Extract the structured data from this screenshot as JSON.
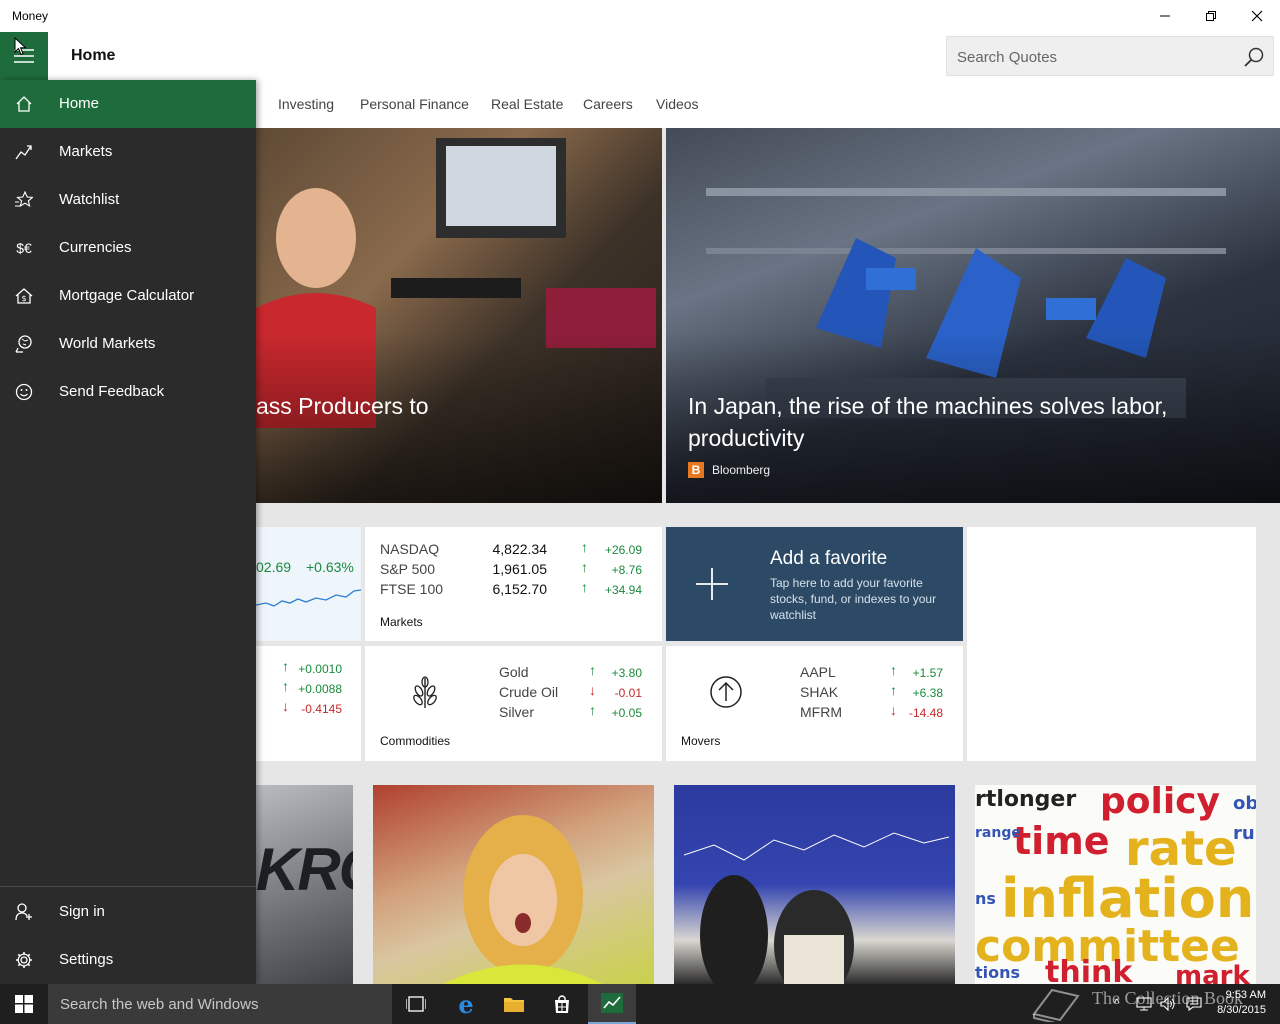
{
  "window": {
    "title": "Money"
  },
  "header": {
    "page_title": "Home",
    "search_placeholder": "Search Quotes"
  },
  "tabs": [
    "Investing",
    "Personal Finance",
    "Real Estate",
    "Careers",
    "Videos"
  ],
  "hero": [
    {
      "headline": "ass Producers to"
    },
    {
      "headline": "In Japan, the rise of the machines solves labor, productivity",
      "source": "Bloomberg"
    }
  ],
  "currency_card": {
    "value": "02.69",
    "change": "+0.63%"
  },
  "markets_card": {
    "label": "Markets",
    "rows": [
      {
        "name": "NASDAQ",
        "value": "4,822.34",
        "change": "+26.09",
        "direction": "up"
      },
      {
        "name": "S&P 500",
        "value": "1,961.05",
        "change": "+8.76",
        "direction": "up"
      },
      {
        "name": "FTSE 100",
        "value": "6,152.70",
        "change": "+34.94",
        "direction": "up"
      }
    ]
  },
  "add_favorite": {
    "title": "Add a favorite",
    "desc": "Tap here to add your favorite stocks, fund, or indexes to your watchlist"
  },
  "currency_changes": [
    {
      "change": "+0.0010",
      "direction": "up"
    },
    {
      "change": "+0.0088",
      "direction": "up"
    },
    {
      "change": "-0.4145",
      "direction": "down"
    }
  ],
  "commodities_card": {
    "label": "Commodities",
    "rows": [
      {
        "name": "Gold",
        "change": "+3.80",
        "direction": "up"
      },
      {
        "name": "Crude Oil",
        "change": "-0.01",
        "direction": "down"
      },
      {
        "name": "Silver",
        "change": "+0.05",
        "direction": "up"
      }
    ]
  },
  "movers_card": {
    "label": "Movers",
    "rows": [
      {
        "name": "AAPL",
        "change": "+1.57",
        "direction": "up"
      },
      {
        "name": "SHAK",
        "change": "+6.38",
        "direction": "up"
      },
      {
        "name": "MFRM",
        "change": "-14.48",
        "direction": "down"
      }
    ]
  },
  "thumbnails": {
    "t1_text": "KRO",
    "wordcloud": [
      "rtlonger",
      "policy",
      "ob",
      "time",
      "run",
      "rate",
      "range",
      "ns",
      "inflation",
      "committee",
      "tions",
      "think",
      "mark"
    ]
  },
  "sidebar": {
    "items": [
      {
        "label": "Home",
        "icon": "home-icon"
      },
      {
        "label": "Markets",
        "icon": "chart-line-icon"
      },
      {
        "label": "Watchlist",
        "icon": "star-list-icon"
      },
      {
        "label": "Currencies",
        "icon": "currency-icon"
      },
      {
        "label": "Mortgage Calculator",
        "icon": "house-dollar-icon"
      },
      {
        "label": "World Markets",
        "icon": "globe-icon"
      },
      {
        "label": "Send Feedback",
        "icon": "smiley-icon"
      }
    ],
    "bottom": [
      {
        "label": "Sign in",
        "icon": "person-add-icon"
      },
      {
        "label": "Settings",
        "icon": "gear-icon"
      }
    ]
  },
  "taskbar": {
    "search_text": "Search the web and Windows",
    "watermark": "The Collection Book",
    "time": "9:53 AM",
    "date": "8/30/2015"
  },
  "colors": {
    "accent": "#1e6b3c",
    "sidebar": "#2b2b2b",
    "up": "#1a8a3c",
    "down": "#c8282b",
    "favorite_tile": "#2c4a66"
  }
}
